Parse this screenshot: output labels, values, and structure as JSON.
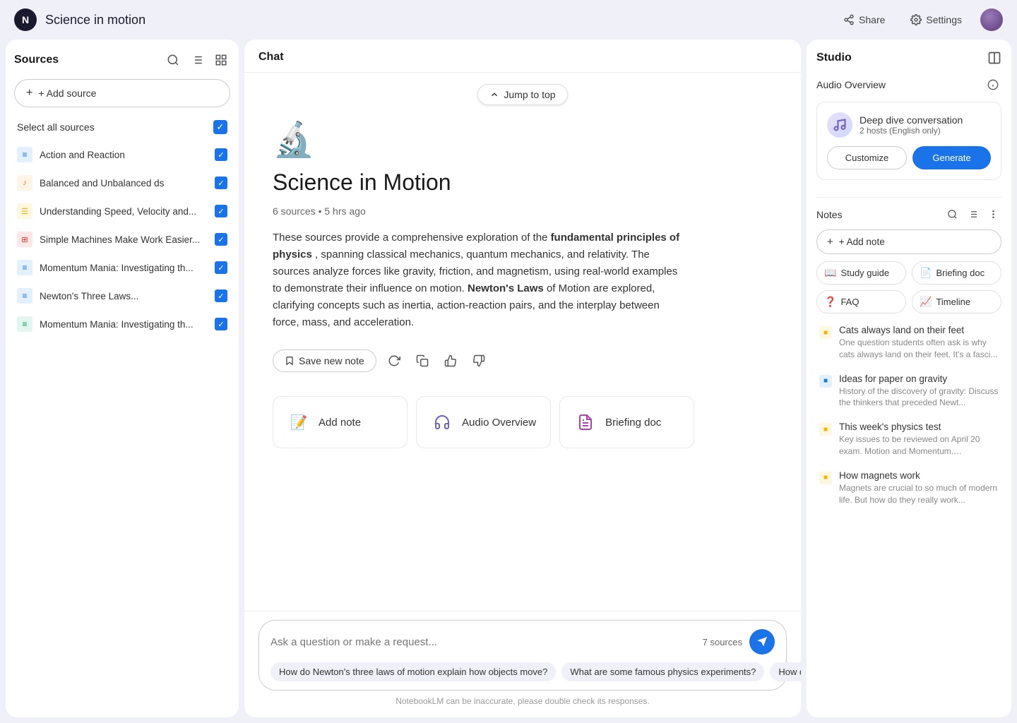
{
  "app": {
    "title": "Science in motion",
    "logo_char": "N"
  },
  "topbar": {
    "share_label": "Share",
    "settings_label": "Settings"
  },
  "sidebar": {
    "title": "Sources",
    "add_source_label": "+ Add source",
    "select_all_label": "Select all sources",
    "sources": [
      {
        "id": 1,
        "name": "Action and Reaction",
        "icon_type": "blue",
        "icon_char": "≡",
        "checked": true
      },
      {
        "id": 2,
        "name": "Balanced and Unbalanced ds",
        "icon_type": "orange",
        "icon_char": "♪",
        "checked": true
      },
      {
        "id": 3,
        "name": "Understanding Speed, Velocity and...",
        "icon_type": "yellow",
        "icon_char": "☰",
        "checked": true
      },
      {
        "id": 4,
        "name": "Simple Machines Make Work Easier...",
        "icon_type": "red",
        "icon_char": "⊞",
        "checked": true
      },
      {
        "id": 5,
        "name": "Momentum Mania: Investigating th...",
        "icon_type": "blue",
        "icon_char": "≡",
        "checked": true
      },
      {
        "id": 6,
        "name": "Newton's Three Laws...",
        "icon_type": "blue",
        "icon_char": "≡",
        "checked": true
      },
      {
        "id": 7,
        "name": "Momentum Mania: Investigating th...",
        "icon_type": "teal",
        "icon_char": "≡",
        "checked": true
      }
    ]
  },
  "chat": {
    "header": "Chat",
    "jump_to_top": "Jump to top",
    "title": "Science in Motion",
    "meta": "6 sources • 5 hrs ago",
    "description_prefix": "These sources provide a comprehensive exploration of the ",
    "description_bold": "fundamental principles of physics",
    "description_suffix": ", spanning classical mechanics, quantum mechanics, and relativity. The sources analyze forces like gravity, friction, and magnetism, using real-world examples to demonstrate their influence on motion. ",
    "description_bold2": "Newton's Laws",
    "description_suffix2": " of Motion are explored, clarifying concepts such as inertia, action-reaction pairs, and the interplay between force, mass, and acceleration.",
    "save_note_label": "Save new note",
    "cards": [
      {
        "icon": "📝",
        "label": "Add note"
      },
      {
        "icon": "🎵",
        "label": "Audio Overview"
      },
      {
        "icon": "📋",
        "label": "Briefing doc"
      }
    ],
    "input_placeholder": "Ask a question or make a request...",
    "sources_count": "7 sources",
    "suggestions": [
      "How do Newton's three laws of motion explain how objects move?",
      "What are some famous physics experiments?",
      "How do the laws of gra at very high speeds or..."
    ],
    "footer_note": "NotebookLM can be inaccurate, please double check its responses."
  },
  "studio": {
    "title": "Studio",
    "audio_overview_label": "Audio Overview",
    "deep_dive_title": "Deep dive conversation",
    "deep_dive_sub": "2 hosts (English only)",
    "customize_label": "Customize",
    "generate_label": "Generate",
    "notes_label": "Notes",
    "add_note_label": "+ Add note",
    "note_types": [
      {
        "icon": "📖",
        "label": "Study guide"
      },
      {
        "icon": "📄",
        "label": "Briefing doc"
      },
      {
        "icon": "❓",
        "label": "FAQ"
      },
      {
        "icon": "📈",
        "label": "Timeline"
      }
    ],
    "notes": [
      {
        "id": 1,
        "title": "Cats always land on their feet",
        "preview": "One question students often ask is why cats always land on their feet. It's a fasci...",
        "color": "yellow"
      },
      {
        "id": 2,
        "title": "Ideas for paper on gravity",
        "preview": "History of the discovery of gravity: Discuss the thinkers that preceded Newt...",
        "color": "blue"
      },
      {
        "id": 3,
        "title": "This week's physics test",
        "preview": "Key issues to be reviewed on April 20 exam. Motion and Momentum. Conserva...",
        "color": "yellow"
      },
      {
        "id": 4,
        "title": "How magnets work",
        "preview": "Magnets are crucial to so much of modern life. But how do they really work...",
        "color": "yellow"
      }
    ]
  }
}
